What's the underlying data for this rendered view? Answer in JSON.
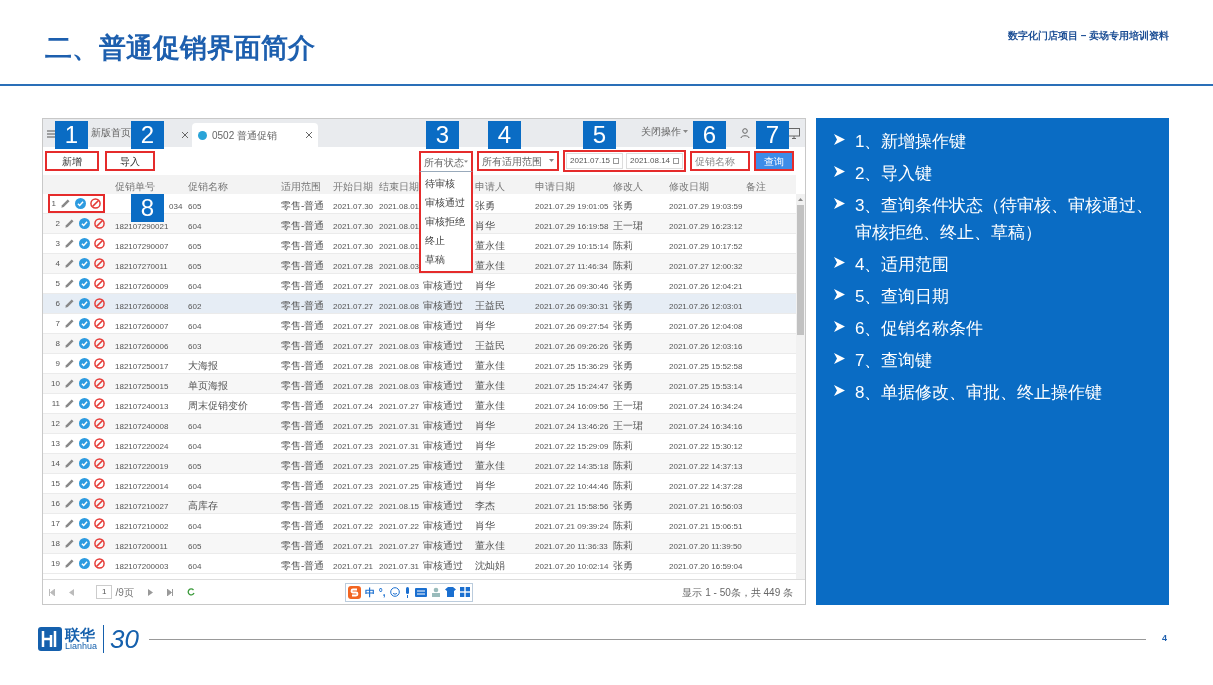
{
  "slide": {
    "title": "二、普通促销界面简介",
    "subtitle": "数字化门店项目 – 卖场专用培训资料",
    "page_number": "4"
  },
  "app": {
    "tabs": [
      {
        "label": "新版首页",
        "selected": false
      },
      {
        "label": "0502 普通促销",
        "selected": true
      }
    ],
    "close_operations": "关闭操作",
    "toolbar": {
      "buttons": [
        "新增",
        "导入"
      ],
      "status_filter": {
        "value": "所有状态",
        "expanded": true,
        "options": [
          "待审核",
          "审核通过",
          "审核拒绝",
          "终止",
          "草稿"
        ]
      },
      "scope_filter": {
        "value": "所有适用范围"
      },
      "date_from": "2021.07.15",
      "date_to": "2021.08.14",
      "name_field": {
        "placeholder": "促销名称"
      },
      "search_button": "查询"
    },
    "table": {
      "columns": [
        "促销单号",
        "促销名称",
        "适用范围",
        "开始日期",
        "结束日期",
        null,
        "申请人",
        "申请日期",
        "修改人",
        "修改日期",
        "备注"
      ],
      "rows": [
        {
          "index": "1",
          "selected": false,
          "cells": [
            "034",
            "605",
            "零售-普通",
            "2021.07.30",
            "2021.08.01",
            null,
            "张勇",
            "2021.07.29 19:01:05",
            "张勇",
            "2021.07.29 19:03:59",
            null
          ]
        },
        {
          "index": "2",
          "selected": false,
          "cells": [
            "182107290021",
            "604",
            "零售-普通",
            "2021.07.30",
            "2021.08.01",
            null,
            "肖华",
            "2021.07.29 16:19:58",
            "王一珺",
            "2021.07.29 16:23:12",
            null
          ]
        },
        {
          "index": "3",
          "selected": false,
          "cells": [
            "182107290007",
            "605",
            "零售-普通",
            "2021.07.30",
            "2021.08.01",
            null,
            "董永佳",
            "2021.07.29 10:15:14",
            "陈莉",
            "2021.07.29 10:17:52",
            null
          ]
        },
        {
          "index": "4",
          "selected": false,
          "cells": [
            "182107270011",
            "605",
            "零售-普通",
            "2021.07.28",
            "2021.08.03",
            null,
            "董永佳",
            "2021.07.27 11:46:34",
            "陈莉",
            "2021.07.27 12:00:32",
            null
          ]
        },
        {
          "index": "5",
          "selected": false,
          "cells": [
            "182107260009",
            "604",
            "零售-普通",
            "2021.07.27",
            "2021.08.03",
            "审核通过",
            "肖华",
            "2021.07.26 09:30:46",
            "张勇",
            "2021.07.26 12:04:21",
            null
          ]
        },
        {
          "index": "6",
          "selected": true,
          "cells": [
            "182107260008",
            "602",
            "零售-普通",
            "2021.07.27",
            "2021.08.08",
            "审核通过",
            "王益民",
            "2021.07.26 09:30:31",
            "张勇",
            "2021.07.26 12:03:01",
            null
          ]
        },
        {
          "index": "7",
          "selected": false,
          "cells": [
            "182107260007",
            "604",
            "零售-普通",
            "2021.07.27",
            "2021.08.08",
            "审核通过",
            "肖华",
            "2021.07.26 09:27:54",
            "张勇",
            "2021.07.26 12:04:08",
            null
          ]
        },
        {
          "index": "8",
          "selected": false,
          "cells": [
            "182107260006",
            "603",
            "零售-普通",
            "2021.07.27",
            "2021.08.03",
            "审核通过",
            "王益民",
            "2021.07.26 09:26:26",
            "张勇",
            "2021.07.26 12:03:16",
            null
          ]
        },
        {
          "index": "9",
          "selected": false,
          "cells": [
            "182107250017",
            "大海报",
            "零售-普通",
            "2021.07.28",
            "2021.08.08",
            "审核通过",
            "董永佳",
            "2021.07.25 15:36:29",
            "张勇",
            "2021.07.25 15:52:58",
            null
          ]
        },
        {
          "index": "10",
          "selected": false,
          "cells": [
            "182107250015",
            "单页海报",
            "零售-普通",
            "2021.07.28",
            "2021.08.03",
            "审核通过",
            "董永佳",
            "2021.07.25 15:24:47",
            "张勇",
            "2021.07.25 15:53:14",
            null
          ]
        },
        {
          "index": "11",
          "selected": false,
          "cells": [
            "182107240013",
            "周末促销变价",
            "零售-普通",
            "2021.07.24",
            "2021.07.27",
            "审核通过",
            "董永佳",
            "2021.07.24 16:09:56",
            "王一珺",
            "2021.07.24 16:34:24",
            null
          ]
        },
        {
          "index": "12",
          "selected": false,
          "cells": [
            "182107240008",
            "604",
            "零售-普通",
            "2021.07.25",
            "2021.07.31",
            "审核通过",
            "肖华",
            "2021.07.24 13:46:26",
            "王一珺",
            "2021.07.24 16:34:16",
            null
          ]
        },
        {
          "index": "13",
          "selected": false,
          "cells": [
            "182107220024",
            "604",
            "零售-普通",
            "2021.07.23",
            "2021.07.31",
            "审核通过",
            "肖华",
            "2021.07.22 15:29:09",
            "陈莉",
            "2021.07.22 15:30:12",
            null
          ]
        },
        {
          "index": "14",
          "selected": false,
          "cells": [
            "182107220019",
            "605",
            "零售-普通",
            "2021.07.23",
            "2021.07.25",
            "审核通过",
            "董永佳",
            "2021.07.22 14:35:18",
            "陈莉",
            "2021.07.22 14:37:13",
            null
          ]
        },
        {
          "index": "15",
          "selected": false,
          "cells": [
            "182107220014",
            "604",
            "零售-普通",
            "2021.07.23",
            "2021.07.25",
            "审核通过",
            "肖华",
            "2021.07.22 10:44:46",
            "陈莉",
            "2021.07.22 14:37:28",
            null
          ]
        },
        {
          "index": "16",
          "selected": false,
          "cells": [
            "182107210027",
            "高库存",
            "零售-普通",
            "2021.07.22",
            "2021.08.15",
            "审核通过",
            "李杰",
            "2021.07.21 15:58:56",
            "张勇",
            "2021.07.21 16:56:03",
            null
          ]
        },
        {
          "index": "17",
          "selected": false,
          "cells": [
            "182107210002",
            "604",
            "零售-普通",
            "2021.07.22",
            "2021.07.22",
            "审核通过",
            "肖华",
            "2021.07.21 09:39:24",
            "陈莉",
            "2021.07.21 15:06:51",
            null
          ]
        },
        {
          "index": "18",
          "selected": false,
          "cells": [
            "182107200011",
            "605",
            "零售-普通",
            "2021.07.21",
            "2021.07.27",
            "审核通过",
            "董永佳",
            "2021.07.20 11:36:33",
            "陈莉",
            "2021.07.20 11:39:50",
            null
          ]
        },
        {
          "index": "19",
          "selected": false,
          "cells": [
            "182107200003",
            "604",
            "零售-普通",
            "2021.07.21",
            "2021.07.31",
            "审核通过",
            "沈灿娟",
            "2021.07.20 10:02:14",
            "张勇",
            "2021.07.20 16:59:04",
            null
          ]
        }
      ]
    },
    "pager": {
      "page": "1",
      "pages": "/9页",
      "summary": "显示 1 - 50条，共 449 条"
    },
    "ime_bar": {
      "labels": [
        "中",
        "°,"
      ]
    }
  },
  "callouts": [
    "1",
    "2",
    "3",
    "4",
    "5",
    "6",
    "7",
    "8"
  ],
  "notes": [
    "1、新增操作键",
    "2、导入键",
    "3、查询条件状态（待审核、审核通过、审核拒绝、终止、草稿）",
    "4、适用范围",
    "5、查询日期",
    "6、促销名称条件",
    "7、查询键",
    "8、单据修改、审批、终止操作键"
  ],
  "logo": {
    "name": "联华",
    "latin": "Lianhua",
    "anniversary": "30"
  }
}
